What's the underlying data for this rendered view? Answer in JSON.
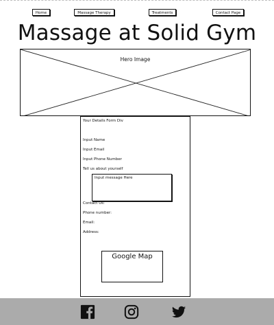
{
  "nav": {
    "home": "Home",
    "massage": "Massage Therapy",
    "treatments": "Treatments",
    "contact": "Contact Page"
  },
  "title": "Massage at Solid Gym",
  "hero": {
    "label": "Hero Image"
  },
  "form": {
    "heading": "Your Details Form Div",
    "name": "Input Name",
    "email": "Input Email",
    "phone": "Input Phone Number",
    "about": "Tell us about yourself",
    "message_placeholder": "Input message Here",
    "contact_us": "Contact Us:",
    "phone_number": "Phone number:",
    "email_label": "Email:",
    "address": "Address:",
    "map": "Google Map"
  },
  "footer": {
    "icons": [
      "facebook-icon",
      "instagram-icon",
      "twitter-icon"
    ],
    "background": "#ababab"
  }
}
